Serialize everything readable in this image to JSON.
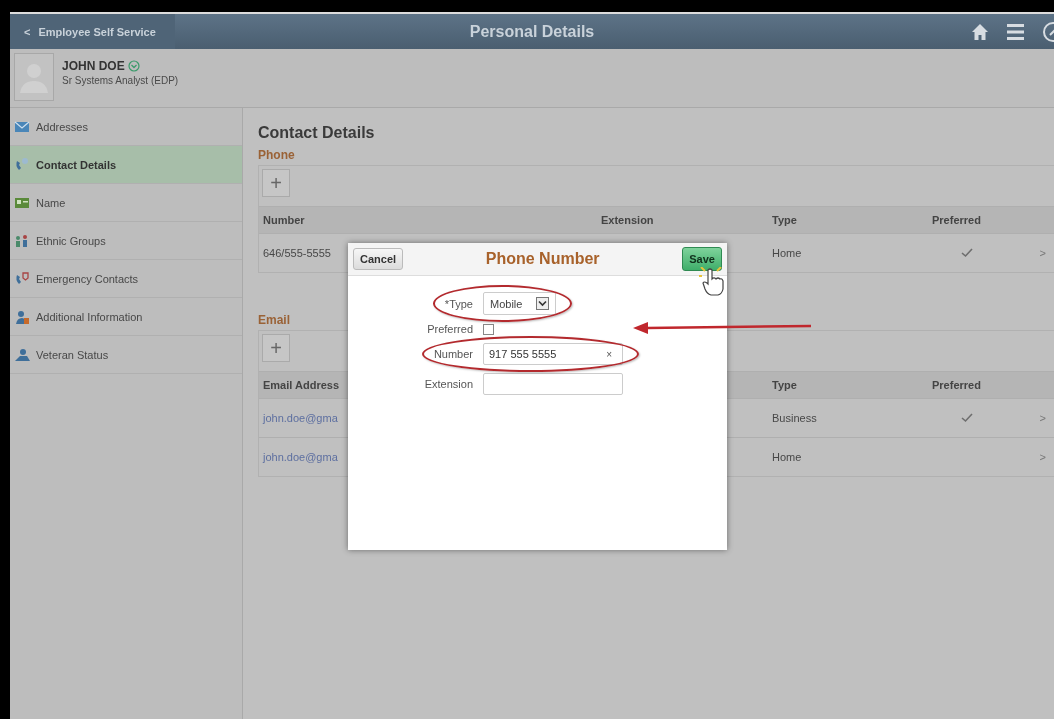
{
  "header": {
    "back": "Employee Self Service",
    "back_icon": "<",
    "title": "Personal Details"
  },
  "profile": {
    "name": "JOHN DOE",
    "job_title": "Sr Systems Analyst (EDP)"
  },
  "sidebar": {
    "items": [
      {
        "label": "Addresses",
        "selected": false
      },
      {
        "label": "Contact Details",
        "selected": true
      },
      {
        "label": "Name",
        "selected": false
      },
      {
        "label": "Ethnic Groups",
        "selected": false
      },
      {
        "label": "Emergency Contacts",
        "selected": false
      },
      {
        "label": "Additional Information",
        "selected": false
      },
      {
        "label": "Veteran Status",
        "selected": false
      }
    ]
  },
  "main": {
    "heading": "Contact Details",
    "sections": [
      {
        "title": "Phone",
        "add": "+",
        "columns": [
          "Number",
          "Extension",
          "Type",
          "Preferred"
        ],
        "rows": [
          {
            "value": "646/555-5555",
            "type": "Home",
            "preferred": true,
            "chevron": ">"
          }
        ]
      },
      {
        "title": "Email",
        "add": "+",
        "columns": [
          "Email Address",
          "Type",
          "Preferred"
        ],
        "rows": [
          {
            "value": "john.doe@gma",
            "type": "Business",
            "preferred": true,
            "chevron": ">"
          },
          {
            "value": "john.doe@gma",
            "type": "Home",
            "preferred": false,
            "chevron": ">"
          }
        ]
      }
    ]
  },
  "dialog": {
    "title": "Phone Number",
    "cancel": "Cancel",
    "save": "Save",
    "fields": [
      {
        "kind": "select",
        "label": "*Type",
        "value": "Mobile",
        "highlighted": true
      },
      {
        "kind": "checkbox",
        "label": "Preferred",
        "checked": false,
        "arrow": true
      },
      {
        "kind": "text",
        "label": "Number",
        "value": "917 555 5555",
        "clear": "×",
        "highlighted": true
      },
      {
        "kind": "text",
        "label": "Extension"
      }
    ]
  }
}
